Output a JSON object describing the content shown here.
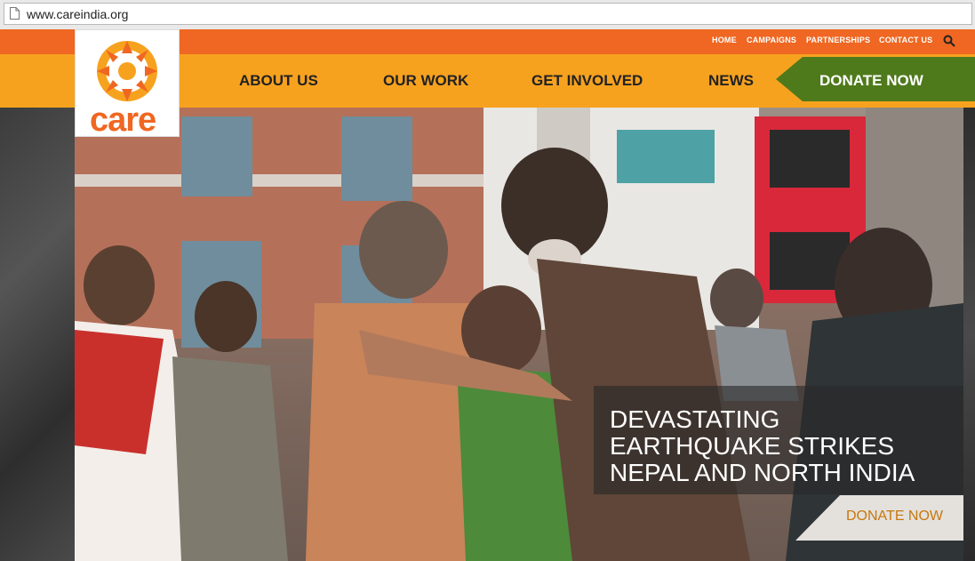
{
  "browser": {
    "url": "www.careindia.org"
  },
  "utility_nav": [
    {
      "label": "HOME"
    },
    {
      "label": "CAMPAIGNS"
    },
    {
      "label": "PARTNERSHIPS"
    },
    {
      "label": "CONTACT US"
    }
  ],
  "logo": {
    "text": "care"
  },
  "main_nav": [
    {
      "label": "ABOUT US"
    },
    {
      "label": "OUR WORK"
    },
    {
      "label": "GET INVOLVED"
    },
    {
      "label": "NEWS"
    }
  ],
  "donate_tab": {
    "label": "DONATE NOW"
  },
  "hero": {
    "headline": "DEVASTATING EARTHQUAKE STRIKES NEPAL AND NORTH INDIA",
    "cta": "DONATE NOW"
  },
  "colors": {
    "orange_dark": "#ef6722",
    "orange": "#f7a21f",
    "green": "#4f7a1c",
    "cta_text": "#c8770d"
  }
}
